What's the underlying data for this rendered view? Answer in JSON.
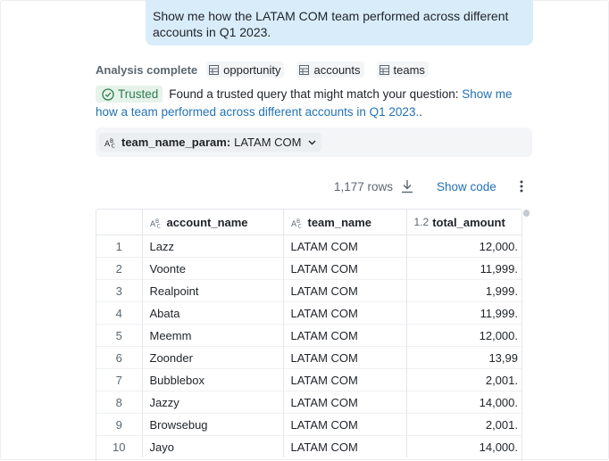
{
  "user_message": "Show me how the LATAM COM team performed across different accounts in Q1 2023.",
  "analysis": {
    "status": "Analysis complete",
    "tables": [
      "opportunity",
      "accounts",
      "teams"
    ]
  },
  "trusted": {
    "badge": "Trusted",
    "text": "Found a trusted query that might match your question:",
    "link": "Show me how a team performed across different accounts in Q1 2023.",
    "suffix": "."
  },
  "parameter": {
    "name": "team_name_param:",
    "value": "LATAM COM"
  },
  "toolbar": {
    "rows": "1,177 rows",
    "show_code": "Show code"
  },
  "grid": {
    "columns": [
      {
        "type": "ABC",
        "name": "account_name"
      },
      {
        "type": "ABC",
        "name": "team_name"
      },
      {
        "type": "1.2",
        "name": "total_amount"
      }
    ],
    "rows": [
      {
        "idx": "1",
        "account": "Lazz",
        "team": "LATAM COM",
        "amount": "12,000."
      },
      {
        "idx": "2",
        "account": "Voonte",
        "team": "LATAM COM",
        "amount": "11,999."
      },
      {
        "idx": "3",
        "account": "Realpoint",
        "team": "LATAM COM",
        "amount": "1,999."
      },
      {
        "idx": "4",
        "account": "Abata",
        "team": "LATAM COM",
        "amount": "11,999."
      },
      {
        "idx": "5",
        "account": "Meemm",
        "team": "LATAM COM",
        "amount": "12,000."
      },
      {
        "idx": "6",
        "account": "Zoonder",
        "team": "LATAM COM",
        "amount": "13,99"
      },
      {
        "idx": "7",
        "account": "Bubblebox",
        "team": "LATAM COM",
        "amount": "2,001."
      },
      {
        "idx": "8",
        "account": "Jazzy",
        "team": "LATAM COM",
        "amount": "14,000."
      },
      {
        "idx": "9",
        "account": "Browsebug",
        "team": "LATAM COM",
        "amount": "2,001."
      },
      {
        "idx": "10",
        "account": "Jayo",
        "team": "LATAM COM",
        "amount": "14,000."
      }
    ]
  },
  "colors": {
    "bubble": "#d9ecfa",
    "link": "#2272b4",
    "trusted_green": "#2e7d4f"
  }
}
